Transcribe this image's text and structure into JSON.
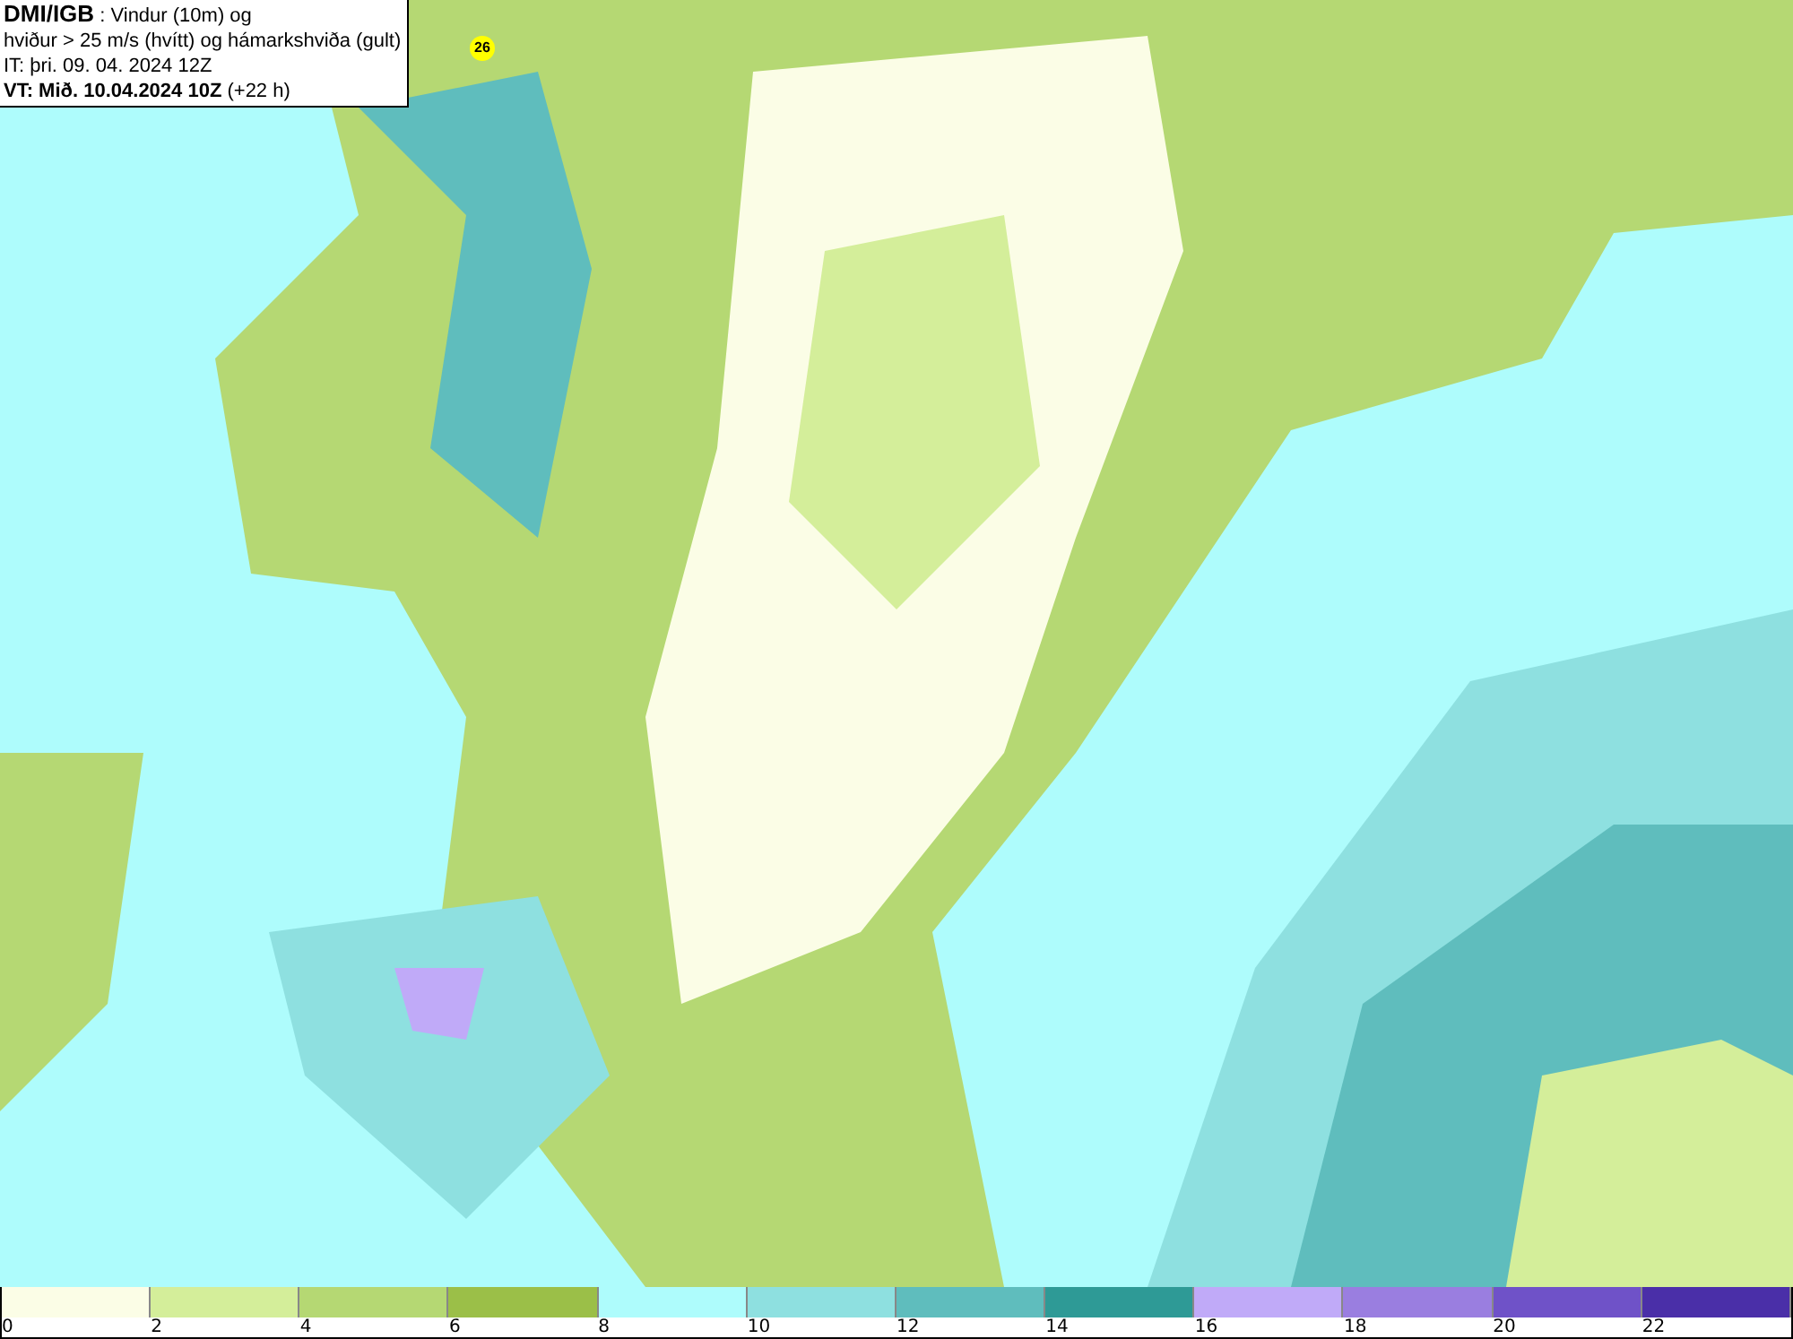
{
  "header": {
    "lines": [
      "**DMI/IGB** : Vindur (10m) og",
      "hviður > 25 m/s (hvítt) og hámarkshviða (gult)",
      "IT: þri. 09. 04. 2024 12Z",
      "**VT: Mið. 10.04.2024 10Z** (+22 h)"
    ]
  },
  "map": {
    "gust_labels": [
      {
        "text": "26"
      }
    ]
  },
  "legend": {
    "items": [
      {
        "label": "0",
        "color": "#fbfde6"
      },
      {
        "label": "2",
        "color": "#d4ee9a"
      },
      {
        "label": "4",
        "color": "#b5d873"
      },
      {
        "label": "6",
        "color": "#9bbf48"
      },
      {
        "label": "8",
        "color": "#aefcfc"
      },
      {
        "label": "10",
        "color": "#8ee0e0"
      },
      {
        "label": "12",
        "color": "#5fbdbd"
      },
      {
        "label": "14",
        "color": "#2e9a96"
      },
      {
        "label": "16",
        "color": "#c0aaf8"
      },
      {
        "label": "18",
        "color": "#9a7ee0"
      },
      {
        "label": "20",
        "color": "#6f52c8"
      },
      {
        "label": "22",
        "color": "#4a2fa8"
      }
    ]
  }
}
